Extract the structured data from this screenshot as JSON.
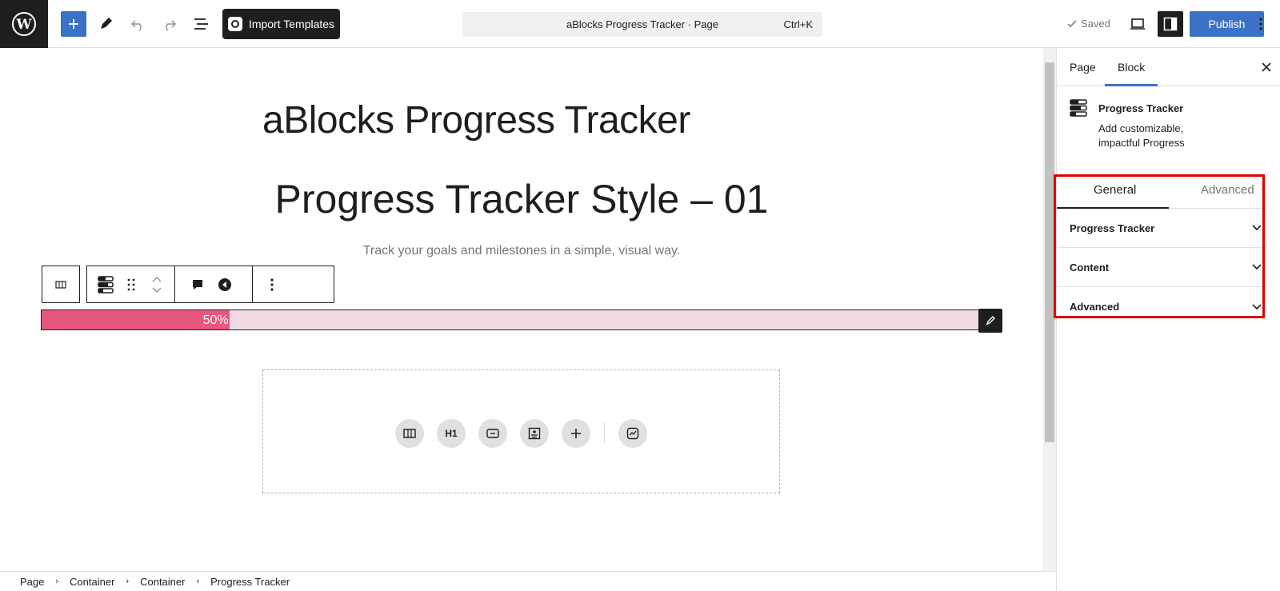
{
  "topbar": {
    "import_label": "Import Templates",
    "command_title": "aBlocks Progress Tracker · Page",
    "command_shortcut": "Ctrl+K",
    "saved_label": "Saved",
    "publish_label": "Publish"
  },
  "canvas": {
    "doc_title": "aBlocks Progress Tracker",
    "heading": "Progress Tracker Style – 01",
    "subtitle": "Track your goals and milestones in a simple, visual way.",
    "progress": {
      "value": 50,
      "label": "50%",
      "fill_color": "#e8577d",
      "track_color": "#f0dbe4"
    },
    "inserter_heading_label": "H1"
  },
  "breadcrumb": {
    "items": [
      "Page",
      "Container",
      "Container",
      "Progress Tracker"
    ],
    "separator": "›"
  },
  "sidebar": {
    "tabs": [
      "Page",
      "Block"
    ],
    "active_tab": "Block",
    "block": {
      "title": "Progress Tracker",
      "description": "Add customizable, impactful Progress"
    },
    "inspector_tabs": [
      "General",
      "Advanced"
    ],
    "active_inspector_tab": "General",
    "panels": [
      "Progress Tracker",
      "Content",
      "Advanced"
    ]
  },
  "colors": {
    "accent": "#3b72c5",
    "dark": "#1e1e1e",
    "highlight": "#e00000"
  }
}
